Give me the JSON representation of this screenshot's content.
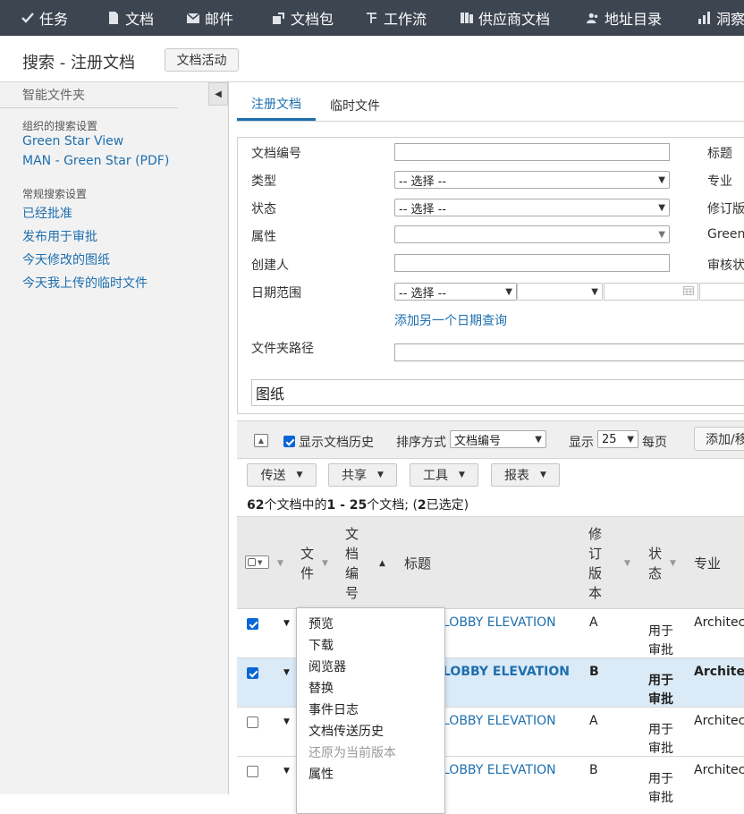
{
  "nav": {
    "items": [
      {
        "label": "任务",
        "icon": "check-icon"
      },
      {
        "label": "文档",
        "icon": "document-icon"
      },
      {
        "label": "邮件",
        "icon": "mail-icon"
      },
      {
        "label": "文档包",
        "icon": "package-icon"
      },
      {
        "label": "工作流",
        "icon": "workflow-icon"
      },
      {
        "label": "供应商文档",
        "icon": "supplier-docs-icon"
      },
      {
        "label": "地址目录",
        "icon": "address-book-icon"
      },
      {
        "label": "洞察",
        "icon": "insights-icon"
      }
    ]
  },
  "header": {
    "title": "搜索 - 注册文档",
    "activity_button": "文档活动"
  },
  "sidebar": {
    "heading": "智能文件夹",
    "org_section": "组织的搜索设置",
    "org_items": [
      "Green Star View",
      "MAN - Green Star (PDF)"
    ],
    "general_section": "常规搜索设置",
    "general_items": [
      "已经批准",
      "发布用于审批",
      "今天修改的图纸",
      "今天我上传的临时文件"
    ]
  },
  "tabs": [
    "注册文档",
    "临时文件"
  ],
  "search": {
    "doc_no_label": "文档编号",
    "type_label": "类型",
    "status_label": "状态",
    "attr_label": "属性",
    "creator_label": "创建人",
    "date_range_label": "日期范围",
    "add_date_link": "添加另一个日期查询",
    "folder_path_label": "文件夹路径",
    "keyword_value": "图纸",
    "select_placeholder": "-- 选择 --",
    "right_labels": [
      "标题",
      "专业",
      "修订版",
      "Green",
      "审核状"
    ]
  },
  "toolbar": {
    "show_history": "显示文档历史",
    "show_history_checked": true,
    "sort_label": "排序方式",
    "sort_value": "文档编号",
    "show_label": "显示",
    "per_page_value": "25",
    "per_page_suffix": "每页",
    "add_button": "添加/移"
  },
  "actions": [
    "传送",
    "共享",
    "工具",
    "报表"
  ],
  "results": {
    "count_prefix": "62",
    "count_mid": "个文档中的",
    "range": "1 - 25",
    "count_suffix": "个文档;  (",
    "selected": "2",
    "selected_suffix": "已选定)"
  },
  "table": {
    "headers": {
      "file": "文件",
      "doc_no": "文档编号",
      "title": "标题",
      "revision": "修订版本",
      "status": "状态",
      "discipline": "专业"
    },
    "rows": [
      {
        "checked": true,
        "selected": false,
        "title": "LOBBY ELEVATION",
        "revision": "A",
        "status": "用于审批",
        "discipline": "Architectu"
      },
      {
        "checked": true,
        "selected": true,
        "title": "LOBBY ELEVATION",
        "revision": "B",
        "status": "用于审批",
        "discipline": "Architectu"
      },
      {
        "checked": false,
        "selected": false,
        "title": "LOBBY ELEVATION",
        "revision": "A",
        "status": "用于审批",
        "discipline": "Architectu"
      },
      {
        "checked": false,
        "selected": false,
        "title": "LOBBY ELEVATION",
        "revision": "B",
        "status": "用于审批",
        "discipline": "Architectu"
      }
    ]
  },
  "context_menu": {
    "items": [
      "预览",
      "下载",
      "阅览器",
      "替换",
      "事件日志",
      "文档传送历史",
      "还原为当前版本",
      "属性"
    ],
    "disabled_index": 6
  },
  "colors": {
    "nav_bg": "#3d4551",
    "link": "#1e6fae",
    "selected_row": "#dbeaf7",
    "checkbox": "#0a66d4"
  }
}
